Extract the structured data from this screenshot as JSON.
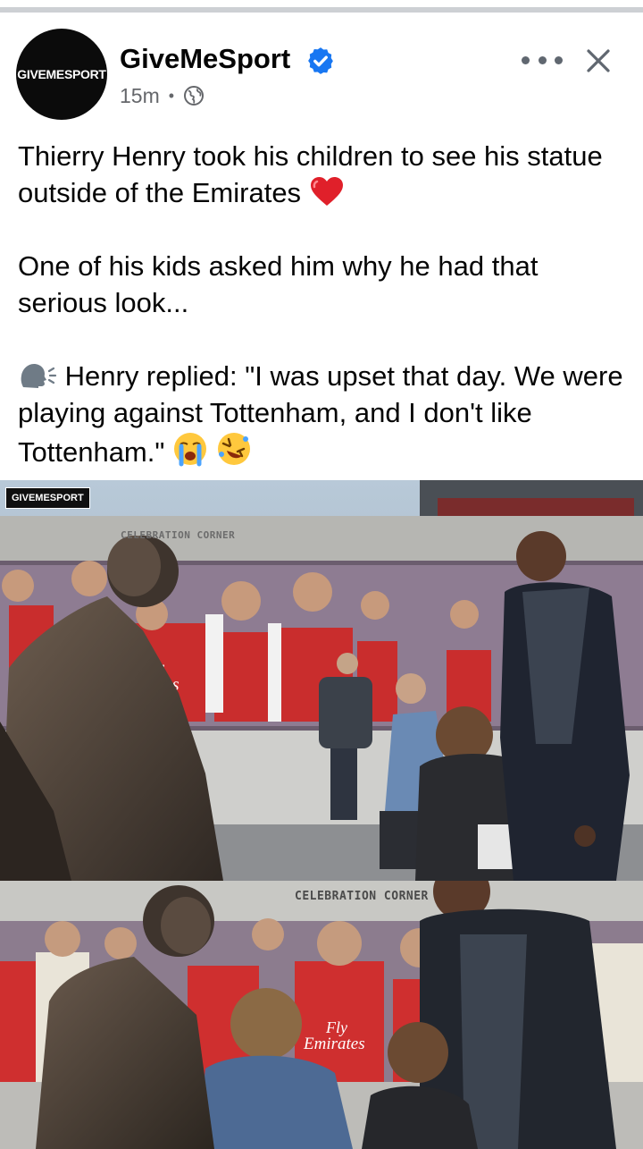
{
  "post": {
    "page_name": "GiveMeSport",
    "avatar_text": "GIVEMESPORT",
    "time": "15m",
    "separator": "•",
    "text_line1": "Thierry Henry took his children to see his statue outside of the Emirates",
    "text_line2": "One of his kids asked him why he had that serious look...",
    "text_line3": "Henry replied: \"I was upset that day. We were playing against Tottenham, and I don't like Tottenham.\""
  },
  "photos": {
    "watermark": "GIVEMESPORT",
    "sign_top": "CELEBRATION CORNER",
    "sign_bottom": "CELEBRATION CORNER",
    "banner_text": "Fly Emirates"
  },
  "icons": {
    "verified": "verified-badge-icon",
    "globe": "globe-icon",
    "more": "more-options-icon",
    "close": "close-icon",
    "heart": "red-heart-emoji",
    "speaking": "speaking-head-emoji",
    "crying": "loudly-crying-emoji",
    "rofl": "rolling-laughing-emoji"
  },
  "colors": {
    "verified_blue": "#1877f2",
    "meta_grey": "#65676b",
    "heart_red": "#e0202a"
  }
}
